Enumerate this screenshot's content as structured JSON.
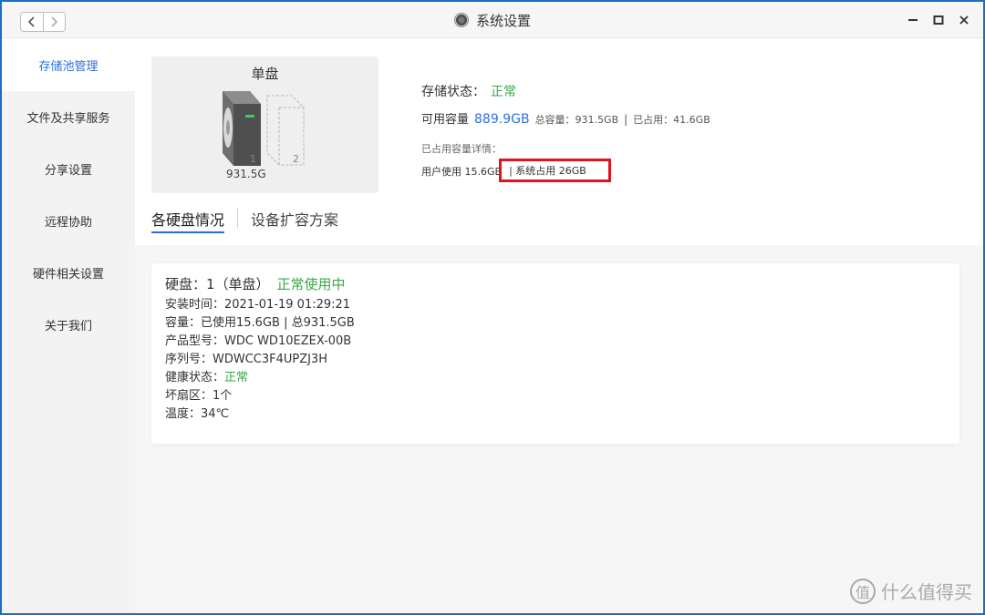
{
  "window": {
    "title": "系统设置"
  },
  "sidebar": {
    "items": [
      {
        "label": "存储池管理"
      },
      {
        "label": "文件及共享服务"
      },
      {
        "label": "分享设置"
      },
      {
        "label": "远程协助"
      },
      {
        "label": "硬件相关设置"
      },
      {
        "label": "关于我们"
      }
    ]
  },
  "disk_card": {
    "title": "单盘",
    "slot1_number": "1",
    "slot2_number": "2",
    "size": "931.5G"
  },
  "storage": {
    "status_label": "存储状态：",
    "status_value": "正常",
    "available_label": "可用容量",
    "available_value": "889.9GB",
    "total": "总容量：931.5GB",
    "separator": "|",
    "used": "已占用：41.6GB",
    "detail_label": "已占用容量详情：",
    "user_usage": "用户使用 15.6GB",
    "system_usage": "| 系统占用 26GB"
  },
  "tabs": [
    {
      "label": "各硬盘情况"
    },
    {
      "label": "设备扩容方案"
    }
  ],
  "hdd_info": {
    "title": "硬盘：1（单盘）",
    "title_status": "正常使用中",
    "install_time": "安装时间：2021-01-19 01:29:21",
    "capacity": "容量：已使用15.6GB | 总931.5GB",
    "model": "产品型号：WDC WD10EZEX-00B",
    "serial": "序列号：WDWCC3F4UPZJ3H",
    "health_label": "健康状态：",
    "health_value": "正常",
    "bad_sectors": "坏扇区：1个",
    "temperature": "温度：34℃"
  },
  "watermark": {
    "logo": "值",
    "text": "什么值得买"
  },
  "colors": {
    "accent": "#2e6fe0",
    "ok": "#3aa846",
    "highlight": "#e0141e",
    "window_border": "#1a6fc4"
  }
}
